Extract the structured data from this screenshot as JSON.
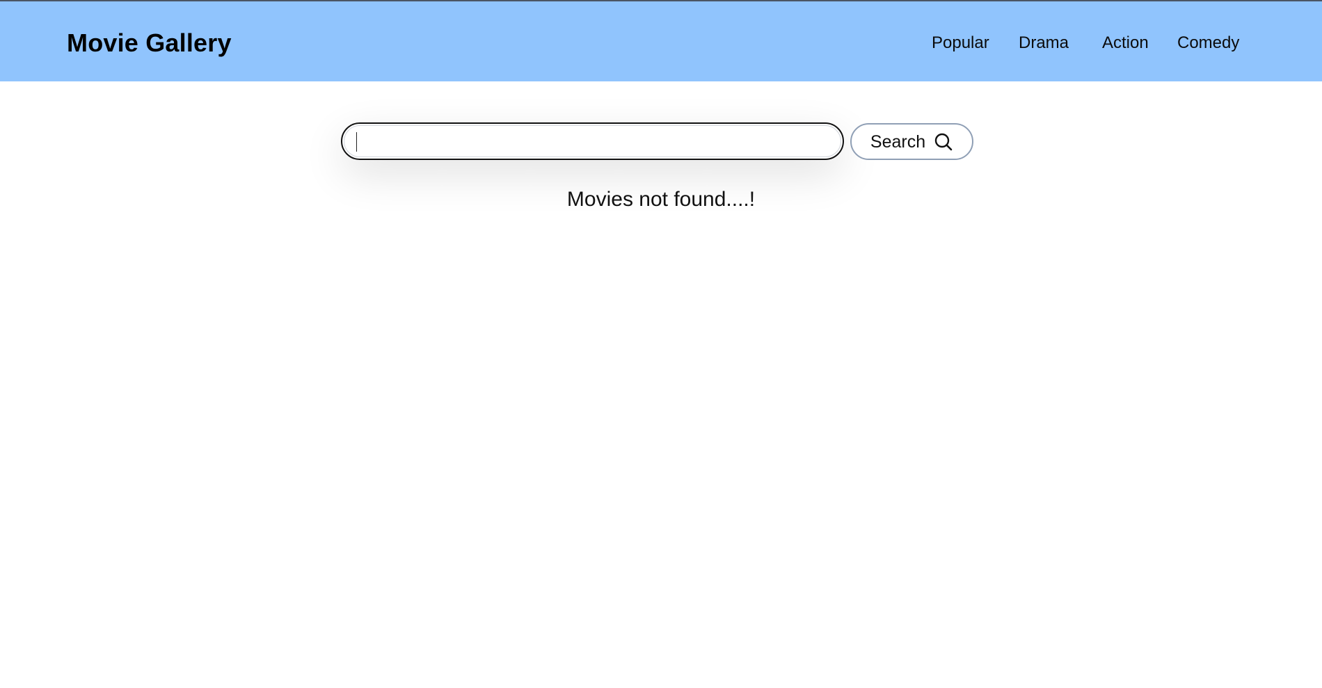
{
  "header": {
    "brand": "Movie Gallery",
    "nav": [
      "Popular",
      "Drama",
      "Action",
      "Comedy"
    ],
    "background_color": "#90c4fd"
  },
  "search": {
    "value": "",
    "placeholder": "",
    "button_label": "Search",
    "button_icon": "search-icon"
  },
  "main": {
    "status_message": "Movies not found....!"
  }
}
